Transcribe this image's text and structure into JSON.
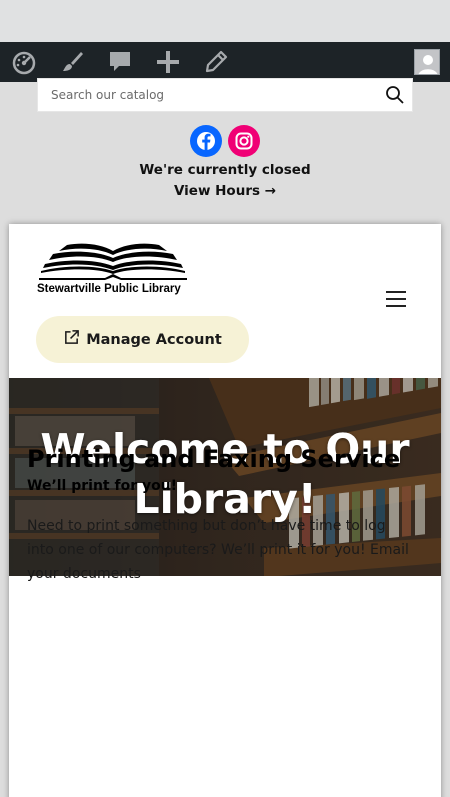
{
  "search": {
    "placeholder": "Search our catalog"
  },
  "status": {
    "closed": "We're currently closed",
    "view_hours": "View Hours →"
  },
  "logo": {
    "name": "Stewartville Public Library"
  },
  "account": {
    "manage_label": "Manage Account"
  },
  "hero": {
    "title": "Welcome to Our Library!"
  },
  "service": {
    "title": "Printing and Faxing Service",
    "subtitle": "We’ll print for you!",
    "body": "Need to print something but don’t have time to log into one of our computers? We’ll print it for you! Email your documents"
  },
  "colors": {
    "admin_bar": "#1d2327",
    "facebook": "#0866ff",
    "instagram": "#f00075",
    "manage_button": "#f6f2d6"
  },
  "icons": [
    "dashboard-icon",
    "customize-brush-icon",
    "comments-icon",
    "add-new-icon",
    "edit-pencil-icon",
    "avatar-icon",
    "search-icon",
    "facebook-icon",
    "instagram-icon",
    "external-link-icon",
    "menu-icon"
  ]
}
